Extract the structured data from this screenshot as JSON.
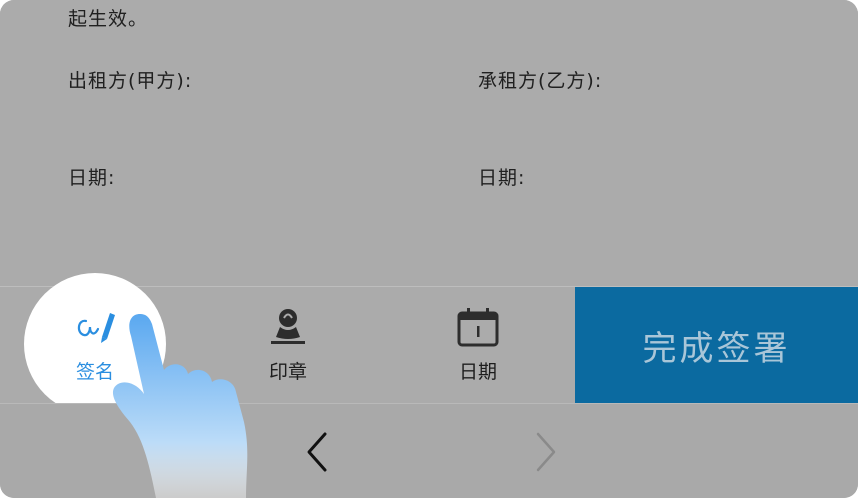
{
  "document": {
    "lines": [
      "起生效。",
      "出租方(甲方):",
      "承租方(乙方):",
      "日期:",
      "日期:"
    ]
  },
  "toolbar": {
    "signature_label": "签名",
    "stamp_label": "印章",
    "date_label": "日期",
    "finish_label": "完成签署"
  },
  "nav": {
    "prev_icon": "chevron-left-icon",
    "next_icon": "chevron-right-icon"
  },
  "colors": {
    "accent": "#2a8ee0",
    "finish_bg": "#0b6aa0",
    "overlay_bg": "#ababab"
  }
}
